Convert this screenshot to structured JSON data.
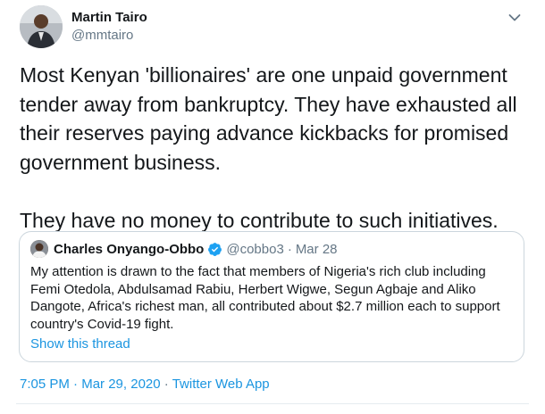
{
  "tweet": {
    "author": {
      "name": "Martin Tairo",
      "handle": "@mmtairo"
    },
    "body": "Most Kenyan 'billionaires' are one unpaid government tender away from bankruptcy. They have exhausted all their reserves paying advance kickbacks for promised government business.\n\nThey have no money to contribute to such initiatives.",
    "quoted": {
      "author": {
        "name": "Charles Onyango-Obbo",
        "handle": "@cobbo3",
        "verified": true
      },
      "separator": "·",
      "date": "Mar 28",
      "text": "My attention is drawn to the fact that members of Nigeria's rich club including Femi Otedola, Abdulsamad Rabiu, Herbert Wigwe, Segun Agbaje and Aliko Dangote, Africa's richest man, all contributed about $2.7 million each to support country's Covid-19 fight.",
      "show_thread": "Show this thread"
    },
    "meta": {
      "time": "7:05 PM",
      "separator": "·",
      "date": "Mar 29, 2020",
      "source": "Twitter Web App"
    }
  },
  "icons": {
    "caret": "chevron-down-icon",
    "verified": "verified-badge-icon"
  },
  "colors": {
    "link": "#1b95e0",
    "secondary_text": "#657786",
    "border": "#ccd6dd",
    "verified": "#1da1f2"
  }
}
